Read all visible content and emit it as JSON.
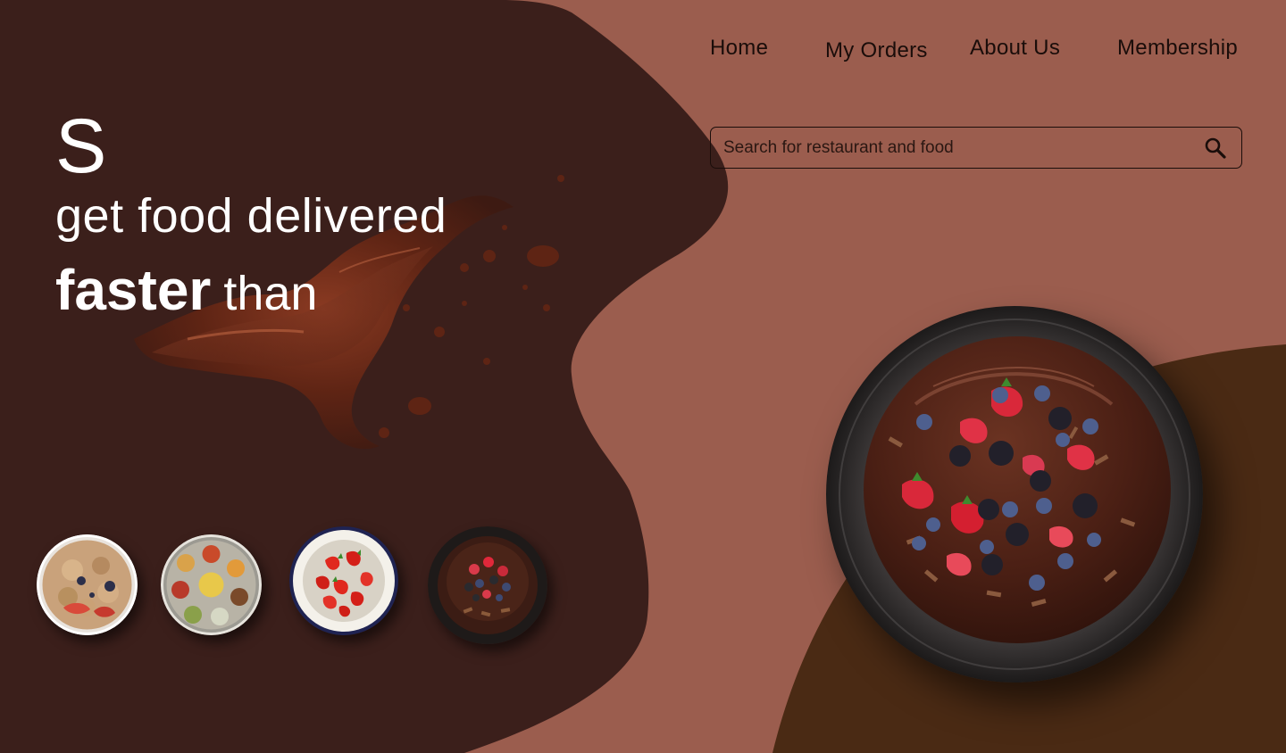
{
  "nav": {
    "items": [
      {
        "label": "Home"
      },
      {
        "label": "My Orders"
      },
      {
        "label": "About Us"
      },
      {
        "label": "Membership"
      }
    ]
  },
  "search": {
    "placeholder": "Search for restaurant and food",
    "icon": "search-icon"
  },
  "hero": {
    "letter": "S",
    "line2": "get food delivered",
    "line3_bold": "faster",
    "line3_light": "than"
  },
  "thumbnails": [
    {
      "name": "oatmeal-bowl"
    },
    {
      "name": "thali-plate"
    },
    {
      "name": "strawberry-bowl"
    },
    {
      "name": "chocolate-berry-cake"
    }
  ],
  "featured": {
    "name": "chocolate-berry-cake"
  },
  "colors": {
    "background": "#9b5d4e",
    "dark_blob": "#3b1f1b",
    "brown_blob": "#4a2a14",
    "text_light": "#ffffff",
    "text_dark": "#1a0d0a"
  }
}
